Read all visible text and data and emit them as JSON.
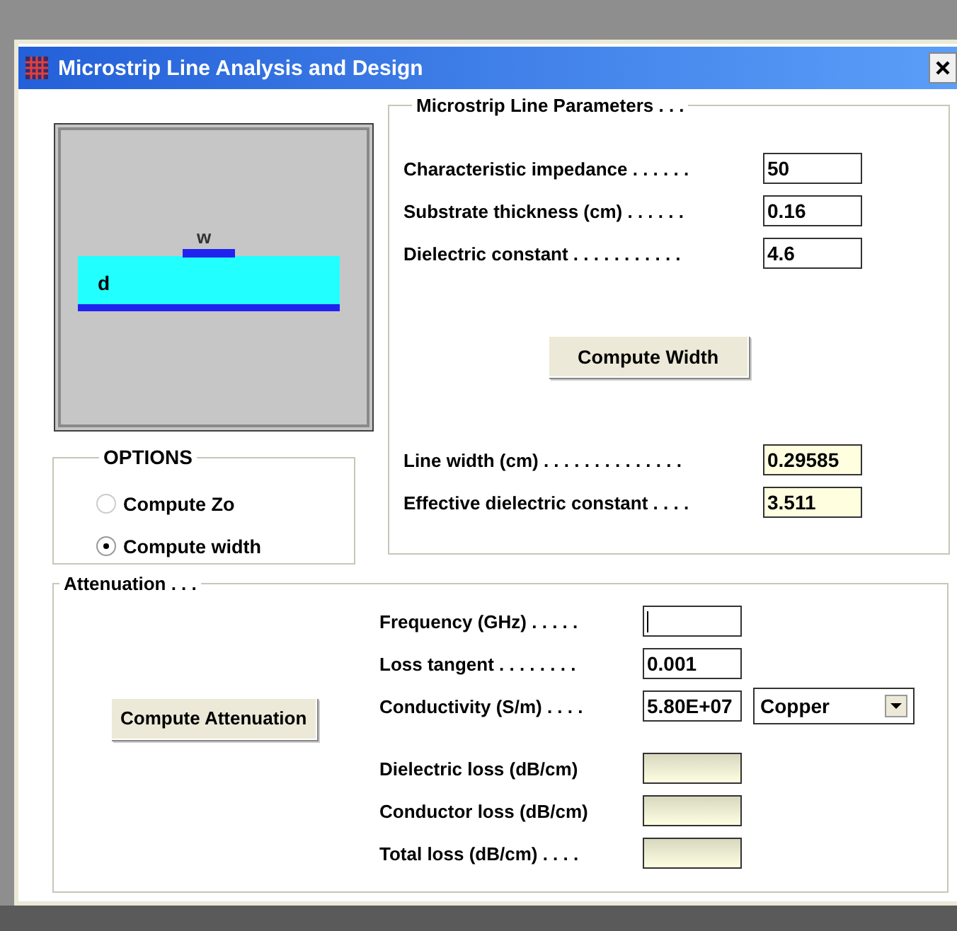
{
  "window": {
    "title": "Microstrip Line Analysis and Design"
  },
  "diagram": {
    "width_label": "w",
    "thickness_label": "d"
  },
  "options": {
    "title": "OPTIONS",
    "radios": [
      {
        "label": "Compute Zo",
        "selected": false
      },
      {
        "label": "Compute width",
        "selected": true
      }
    ]
  },
  "parameters": {
    "title": "Microstrip Line Parameters . . .",
    "inputs": [
      {
        "label": "Characteristic impedance . . . . . .",
        "value": "50",
        "kind": "input"
      },
      {
        "label": "Substrate thickness (cm) . . . . . .",
        "value": "0.16",
        "kind": "input"
      },
      {
        "label": "Dielectric constant . . . . . . . . . . .",
        "value": "4.6",
        "kind": "input"
      }
    ],
    "button": "Compute Width",
    "outputs": [
      {
        "label": "Line width (cm) . . . . . . . . . . . . . .",
        "value": "0.29585",
        "kind": "output"
      },
      {
        "label": "Effective dielectric constant . . . .",
        "value": "3.511",
        "kind": "output"
      }
    ]
  },
  "attenuation": {
    "title": "Attenuation . . .",
    "button": "Compute Attenuation",
    "inputs": [
      {
        "label": "Frequency (GHz) . . . . .",
        "kind": "input",
        "focused": true
      },
      {
        "label": "Loss tangent . . . . . . . .",
        "value": "0.001",
        "kind": "input"
      },
      {
        "label": "Conductivity (S/m) . . . .",
        "value": "5.80E+07",
        "kind": "input"
      }
    ],
    "material": "Copper",
    "outputs": [
      {
        "label": "Dielectric loss (dB/cm)",
        "kind": "result"
      },
      {
        "label": "Conductor loss (dB/cm)",
        "kind": "result"
      },
      {
        "label": "Total loss (dB/cm) . . . .",
        "kind": "result"
      }
    ]
  }
}
